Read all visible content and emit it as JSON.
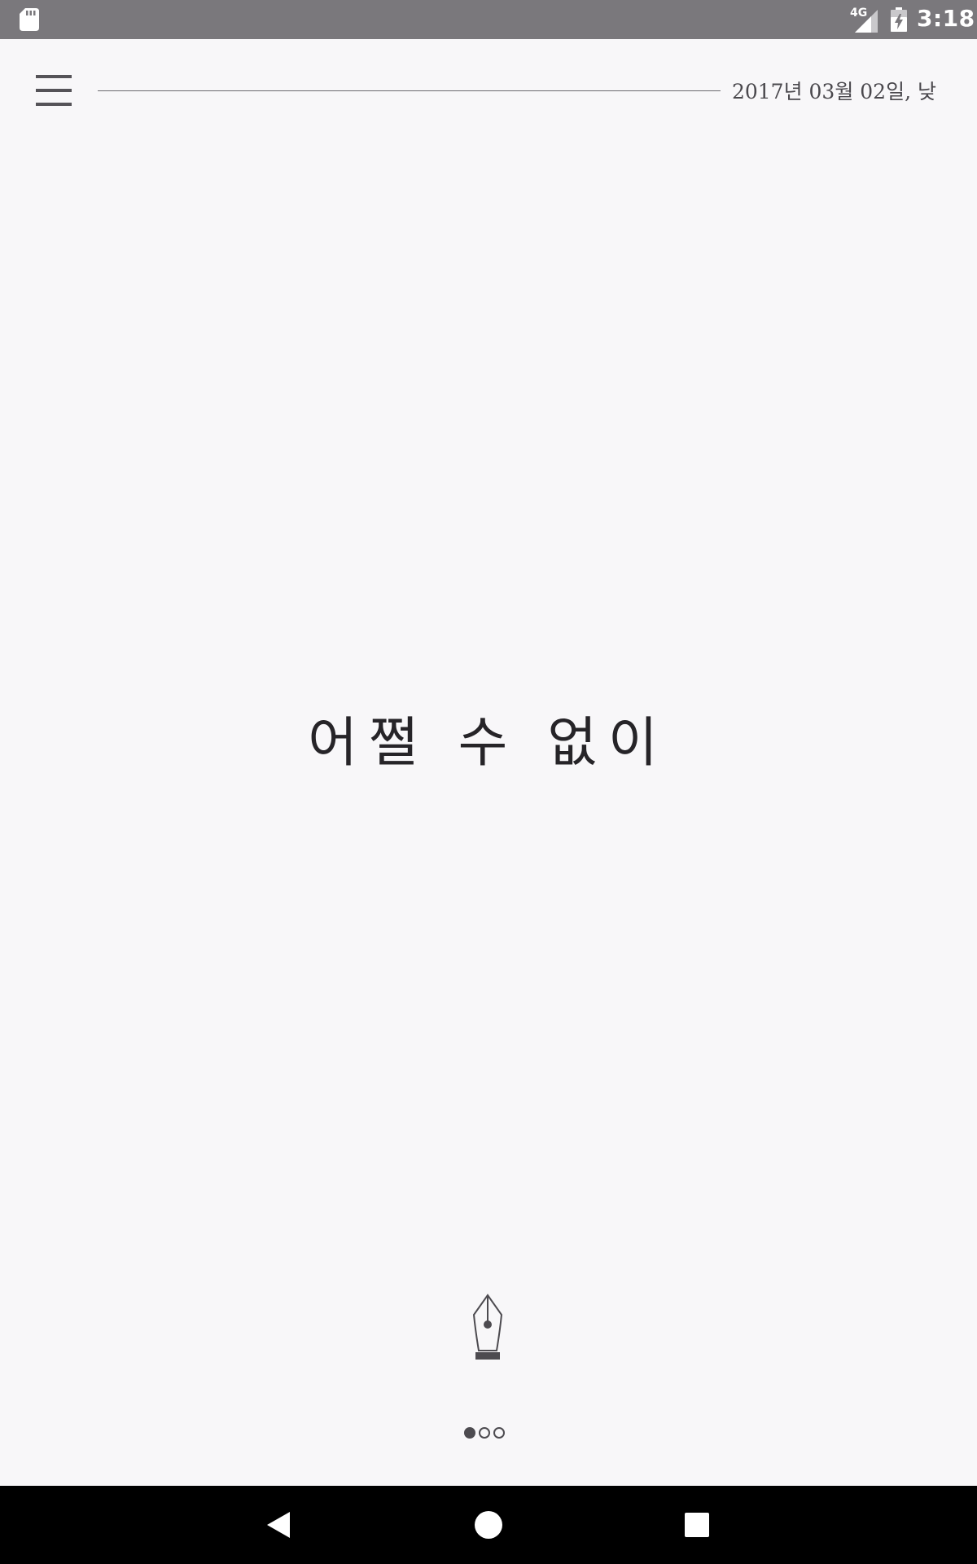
{
  "status_bar": {
    "network_type": "4G",
    "time": "3:18",
    "icons": [
      "sd-card-icon",
      "signal-icon",
      "battery-charging-icon"
    ]
  },
  "header": {
    "menu_icon": "hamburger-menu-icon",
    "date": "2017년 03월 02일, 낮"
  },
  "main": {
    "title": "어쩔 수 없이"
  },
  "actions": {
    "write_icon": "fountain-pen-icon"
  },
  "pager": {
    "count": 3,
    "active_index": 0
  },
  "navigation": {
    "icons": [
      "back-icon",
      "home-icon",
      "recents-icon"
    ]
  },
  "colors": {
    "background": "#f8f7f9",
    "status_bar": "#7a787c",
    "text": "#262428",
    "nav_bar": "#000000"
  }
}
